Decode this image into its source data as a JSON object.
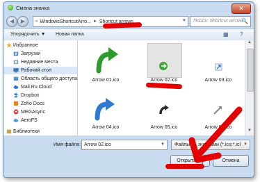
{
  "window": {
    "title": "Смена значка",
    "close": "✕"
  },
  "address": {
    "path": [
      "WindowsShortcutArro...",
      "Shortcut arrows"
    ],
    "separator": "►",
    "leading": "«",
    "back": "◀",
    "forward": "▶",
    "dropdown": "▼"
  },
  "search": {
    "placeholder": "Поиск: Shortcut arrows",
    "icon": "🔍"
  },
  "toolbar": {
    "organize": "Упорядочить ▼",
    "new_folder": "Новая папка",
    "view_icon": "▦",
    "help_icon": "?"
  },
  "sidebar": {
    "items": [
      {
        "label": "Избранное",
        "icon": "star-icon",
        "color": "#e2b33c"
      },
      {
        "label": "Загрузки",
        "icon": "downloads-icon",
        "color": "#4a7fc1"
      },
      {
        "label": "Недавние места",
        "icon": "recent-places-icon",
        "color": "#7aa0c8"
      },
      {
        "label": "Рабочий стол",
        "icon": "desktop-icon",
        "color": "#3f6fb5"
      },
      {
        "label": "Область общего доступа",
        "icon": "shared-area-icon",
        "color": "#5c8fd0"
      },
      {
        "label": "Mail.Ru Cloud",
        "icon": "cloud-icon",
        "color": "#2f78d1"
      },
      {
        "label": "Dropbox",
        "icon": "dropbox-icon",
        "color": "#2f7fd8"
      },
      {
        "label": "Zoho Docs",
        "icon": "zoho-icon",
        "color": "#e08a1e"
      },
      {
        "label": "MEGAsync",
        "icon": "mega-icon",
        "color": "#d8262b"
      },
      {
        "label": "AeroFS",
        "icon": "aerofs-icon",
        "color": "#4a9ee0"
      },
      {
        "label": "Библиотеки",
        "icon": "libraries-icon",
        "color": "#caa24a"
      }
    ]
  },
  "files": [
    {
      "name": "Arrow 01.ico",
      "icon": "green-curved-arrow-icon"
    },
    {
      "name": "Arrow 02.ico",
      "icon": "green-round-arrow-icon"
    },
    {
      "name": "Arrow 03.ico",
      "icon": "small-blue-arrow-icon"
    },
    {
      "name": "Arrow 04.ico",
      "icon": "blue-curved-arrow-icon"
    },
    {
      "name": "Arrow 05.ico",
      "icon": "black-arrow-icon"
    },
    {
      "name": "Arrow 06.ico",
      "icon": "grey-arrow-icon"
    }
  ],
  "bottom": {
    "file_name_label": "Имя файла:",
    "file_name_value": "Arrow 02.ico",
    "file_type": "Файлы со значками (*.ico;*.icl",
    "open": "Открыть",
    "cancel": "Отмена"
  }
}
